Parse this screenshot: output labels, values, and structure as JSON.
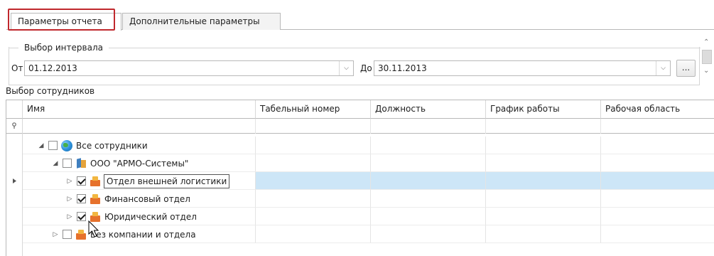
{
  "tabs": [
    {
      "label": "Параметры отчета",
      "active": true
    },
    {
      "label": "Дополнительные параметры",
      "active": false
    }
  ],
  "interval": {
    "group_title": "Выбор интервала",
    "from_label": "От",
    "from_value": "01.12.2013",
    "to_label": "До",
    "to_value": "30.11.2013",
    "more_button": "..."
  },
  "employees": {
    "section_label": "Выбор сотрудников",
    "columns": [
      "Имя",
      "Табельный номер",
      "Должность",
      "График работы",
      "Рабочая область"
    ],
    "filter_icon": "pin-icon",
    "tree": [
      {
        "label": "Все сотрудники",
        "icon": "globe-icon",
        "checked": false,
        "expanded": true
      },
      {
        "label": "ООО \"АРМО-Системы\"",
        "icon": "company-icon",
        "checked": false,
        "expanded": true
      },
      {
        "label": "Отдел внешней логистики",
        "icon": "department-icon",
        "checked": true,
        "expanded": false,
        "selected": true
      },
      {
        "label": "Финансовый отдел",
        "icon": "department-icon",
        "checked": true,
        "expanded": false
      },
      {
        "label": "Юридический отдел",
        "icon": "department-icon",
        "checked": true,
        "expanded": false
      },
      {
        "label": "Без компании и отдела",
        "icon": "department-icon",
        "checked": false,
        "expanded": false
      }
    ]
  },
  "colors": {
    "highlight_border": "#c0282d",
    "selection": "#cde6f7"
  }
}
